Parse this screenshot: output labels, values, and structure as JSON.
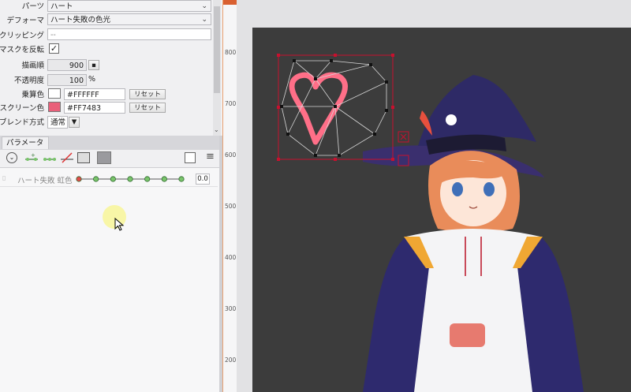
{
  "properties": {
    "parts_label": "パーツ",
    "parts_value": "ハート",
    "deformer_label": "デフォーマ",
    "deformer_value": "ハート失敗の色光",
    "clipping_label": "クリッピング",
    "clipping_value": "--",
    "mask_invert_label": "マスクを反転",
    "draw_order_label": "描画順",
    "draw_order_value": "900",
    "opacity_label": "不透明度",
    "opacity_value": "100",
    "opacity_unit": "%",
    "multiply_label": "乗算色",
    "multiply_value": "#FFFFFF",
    "multiply_color": "#FFFFFF",
    "screen_label": "スクリーン色",
    "screen_value": "#FF7483",
    "screen_color": "#FF7483",
    "reset_label": "リセット",
    "blend_label": "ブレンド方式",
    "blend_value": "通常"
  },
  "parameter_panel": {
    "tab_label": "パラメータ",
    "param_name": "ハート失敗 虹色",
    "param_value": "0.0",
    "key_count": 7
  },
  "ruler": {
    "marks": [
      "800",
      "700",
      "600",
      "500",
      "400",
      "300",
      "200"
    ]
  },
  "colors": {
    "canvas_bg": "#3c3c3c",
    "selection": "#c8102e",
    "heart": "#ff6f88",
    "accent_orange": "#e98c5a"
  }
}
